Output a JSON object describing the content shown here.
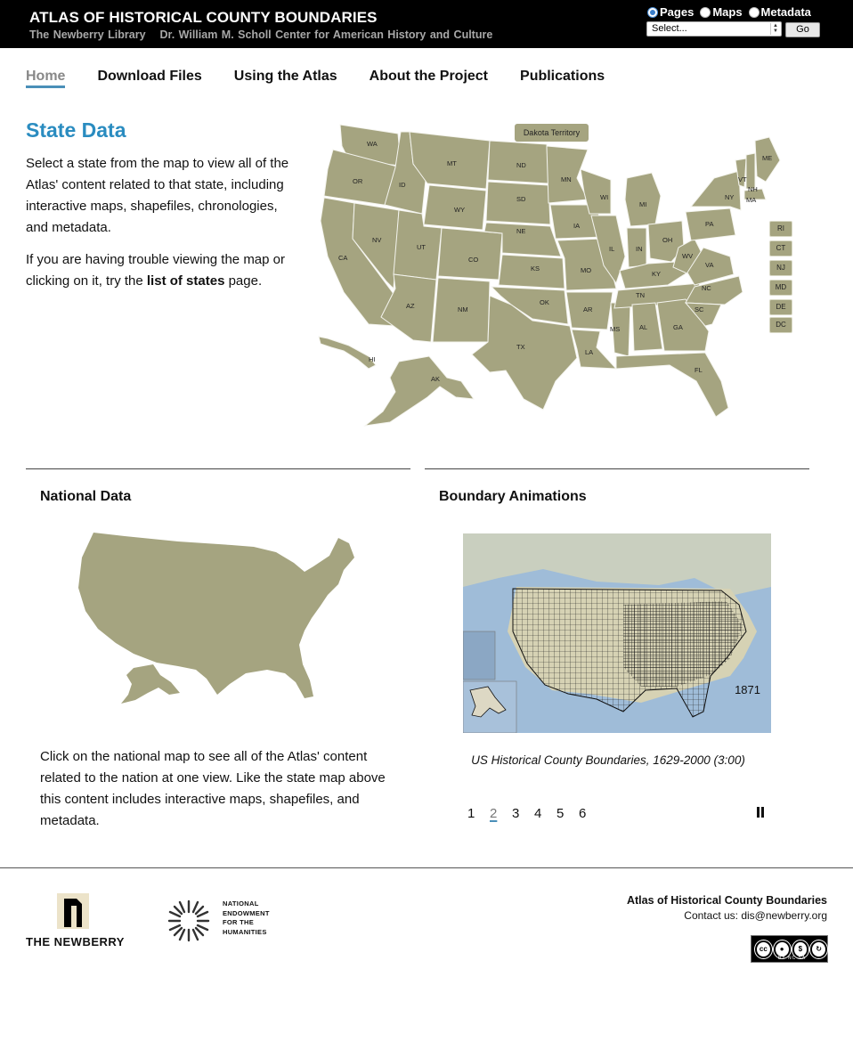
{
  "header": {
    "title": "ATLAS OF HISTORICAL COUNTY BOUNDARIES",
    "subtitle_org": "The Newberry Library",
    "subtitle_center": "Dr. William M. Scholl Center for American History and Culture",
    "search_modes": [
      {
        "label": "Pages",
        "checked": true
      },
      {
        "label": "Maps",
        "checked": false
      },
      {
        "label": "Metadata",
        "checked": false
      }
    ],
    "select_value": "Select...",
    "go_label": "Go"
  },
  "nav": [
    "Home",
    "Download Files",
    "Using the Atlas",
    "About the Project",
    "Publications"
  ],
  "state_section": {
    "title": "State Data",
    "paragraph1": "Select a state from the map to view all of the Atlas' content related to that state, including interactive maps, shapefiles, chronologies, and metadata.",
    "paragraph2_before": "If you are having trouble viewing the map or clicking on it, try the ",
    "paragraph2_link": "list of states",
    "paragraph2_after": " page.",
    "dakota_label": "Dakota Territory",
    "small_states": [
      "RI",
      "CT",
      "NJ",
      "MD",
      "DE",
      "DC"
    ],
    "state_labels": [
      "WA",
      "OR",
      "CA",
      "ID",
      "NV",
      "MT",
      "WY",
      "UT",
      "AZ",
      "CO",
      "NM",
      "ND",
      "SD",
      "NE",
      "KS",
      "OK",
      "TX",
      "MN",
      "IA",
      "MO",
      "AR",
      "LA",
      "WI",
      "IL",
      "MS",
      "MI",
      "IN",
      "KY",
      "TN",
      "AL",
      "OH",
      "WV",
      "VA",
      "NC",
      "SC",
      "GA",
      "FL",
      "PA",
      "NY",
      "VT",
      "NH",
      "ME",
      "MA",
      "HI",
      "AK"
    ]
  },
  "national_section": {
    "title": "National Data",
    "text": "Click on the national map to see all of the Atlas' content related to the nation at one view. Like the state map above this content includes interactive maps, shapefiles, and metadata."
  },
  "animations_section": {
    "title": "Boundary Animations",
    "year": "1871",
    "caption": "US Historical County Boundaries, 1629-2000 (3:00)",
    "pages": [
      "1",
      "2",
      "3",
      "4",
      "5",
      "6"
    ],
    "active_page": "2"
  },
  "footer": {
    "newberry": "THE NEWBERRY",
    "neh": "NATIONAL\nENDOWMENT\nFOR THE\nHUMANITIES",
    "org": "Atlas of Historical County Boundaries",
    "contact": "Contact us: dis@newberry.org",
    "license_labels": "BY   NC   SA"
  },
  "colors": {
    "map_fill": "#a5a480",
    "title_blue": "#2a8cc0"
  }
}
